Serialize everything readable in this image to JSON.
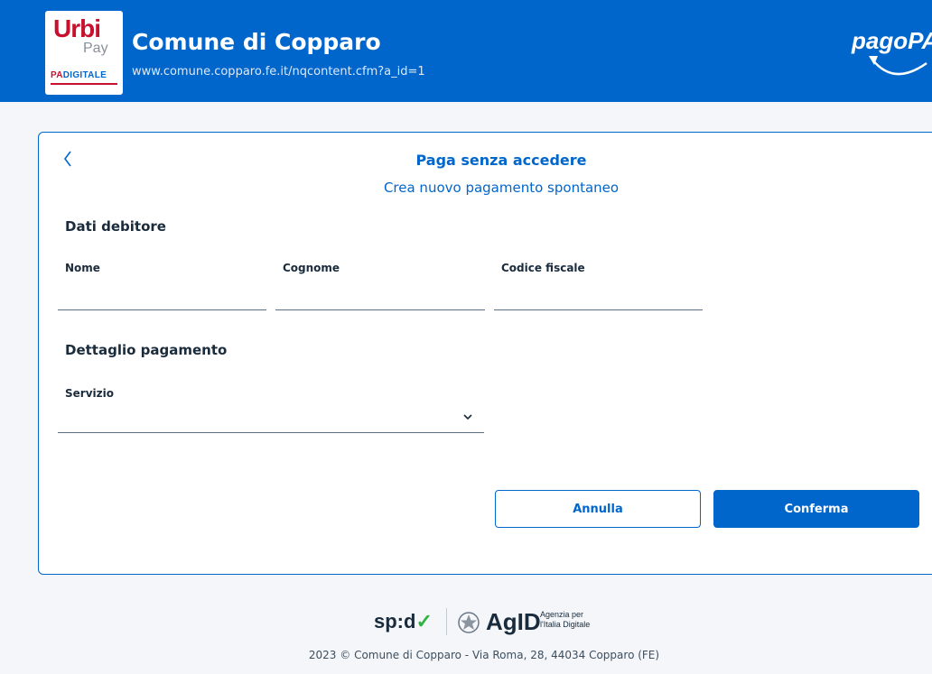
{
  "header": {
    "logo": {
      "urbi": "Urbi",
      "pay": "Pay",
      "padigitale_pa": "PA",
      "padigitale_rest": "DIGITALE"
    },
    "title": "Comune di Copparo",
    "url": "www.comune.copparo.fe.it/nqcontent.cfm?a_id=1",
    "pagopa_logo": "pagoPA"
  },
  "card": {
    "back_icon": "chevron-left-icon",
    "title": "Paga senza accedere",
    "subtitle": "Crea nuovo pagamento spontaneo",
    "debtor_section": {
      "title": "Dati debitore",
      "fields": [
        {
          "label": "Nome",
          "value": "",
          "placeholder": ""
        },
        {
          "label": "Cognome",
          "value": "",
          "placeholder": ""
        },
        {
          "label": "Codice fiscale",
          "value": "",
          "placeholder": ""
        }
      ]
    },
    "payment_section": {
      "title": "Dettaglio pagamento",
      "service_label": "Servizio",
      "service_value": "",
      "service_icon": "chevron-down-icon"
    },
    "buttons": {
      "cancel": "Annulla",
      "confirm": "Conferma"
    }
  },
  "footer": {
    "spid_logo": "sp:d",
    "agid_logo": "AgID",
    "agid_subtitle_line1": "Agenzia per",
    "agid_subtitle_line2": "l'Italia Digitale",
    "copyright": "2023 © Comune di Copparo - Via Roma, 28, 44034 Copparo (FE)"
  },
  "colors": {
    "primary": "#0066cc",
    "logo_red": "#c8102e",
    "text": "#1a2b3c",
    "spid_green": "#2fb344"
  }
}
